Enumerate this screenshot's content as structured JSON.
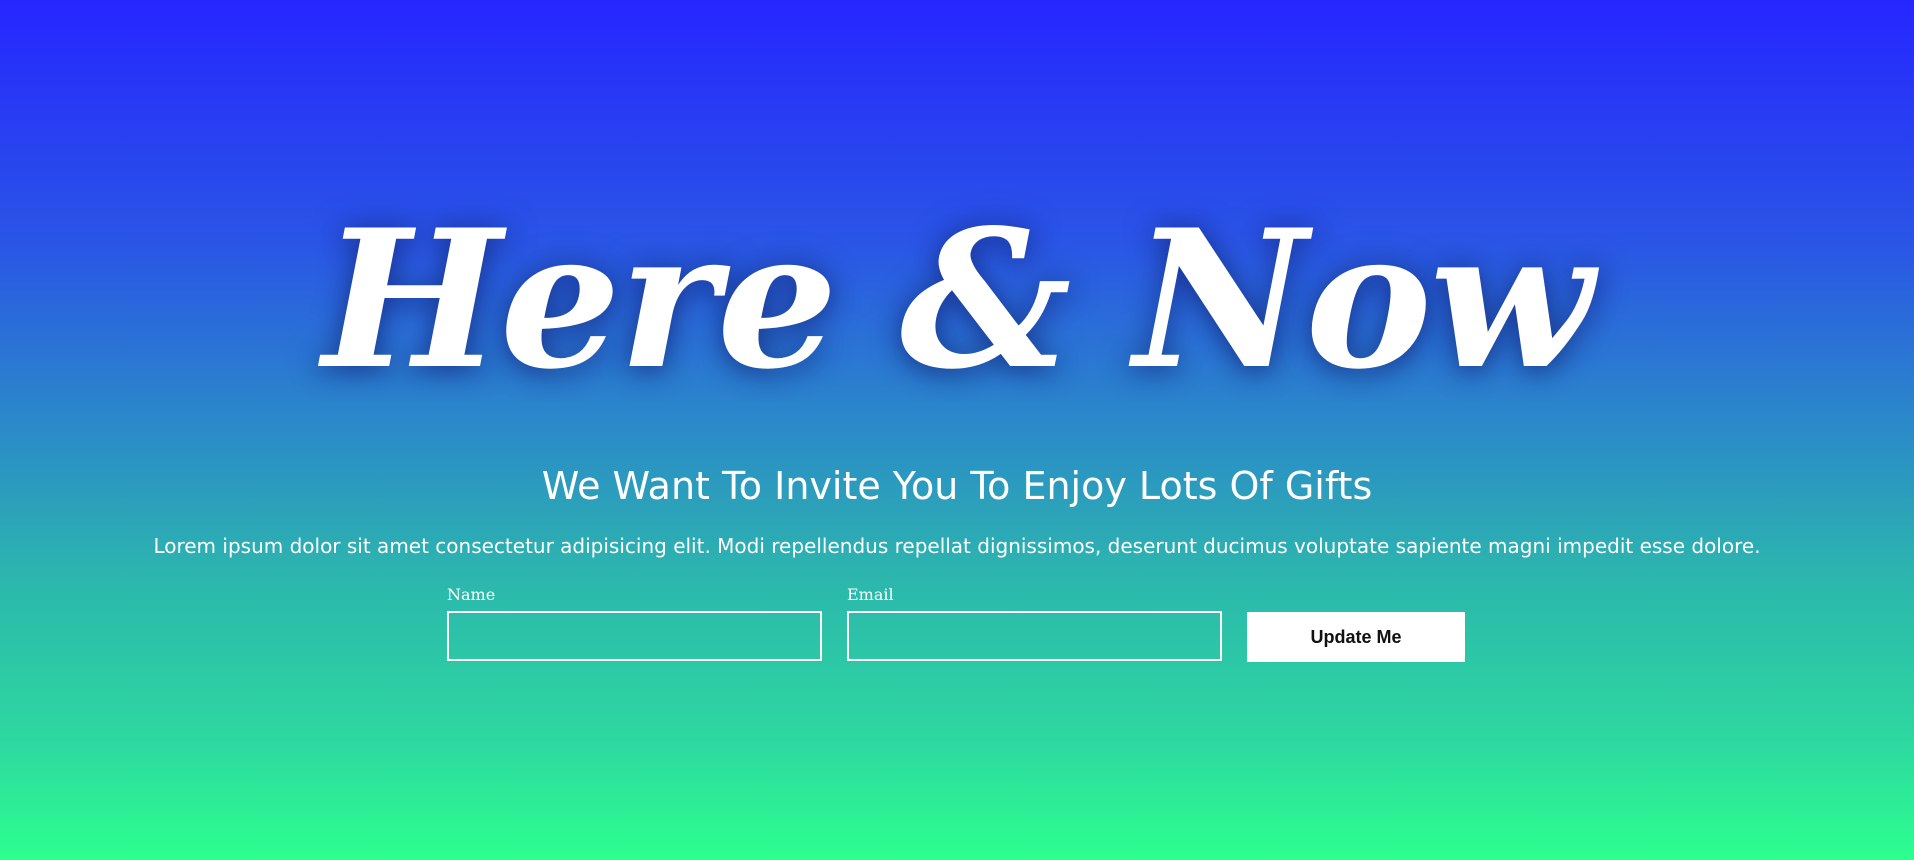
{
  "hero": {
    "title": "Here & Now",
    "subtitle": "We Want To Invite You To Enjoy Lots Of Gifts",
    "description": "Lorem ipsum dolor sit amet consectetur adipisicing elit. Modi repellendus repellat dignissimos, deserunt ducimus voluptate sapiente magni impedit esse dolore."
  },
  "form": {
    "name_label": "Name",
    "name_value": "",
    "email_label": "Email",
    "email_value": "",
    "submit_label": "Update Me"
  },
  "colors": {
    "gradient_top": "#2626ff",
    "gradient_bottom": "#2dff8e",
    "text": "#ffffff",
    "button_bg": "#ffffff",
    "button_text": "#111111"
  }
}
